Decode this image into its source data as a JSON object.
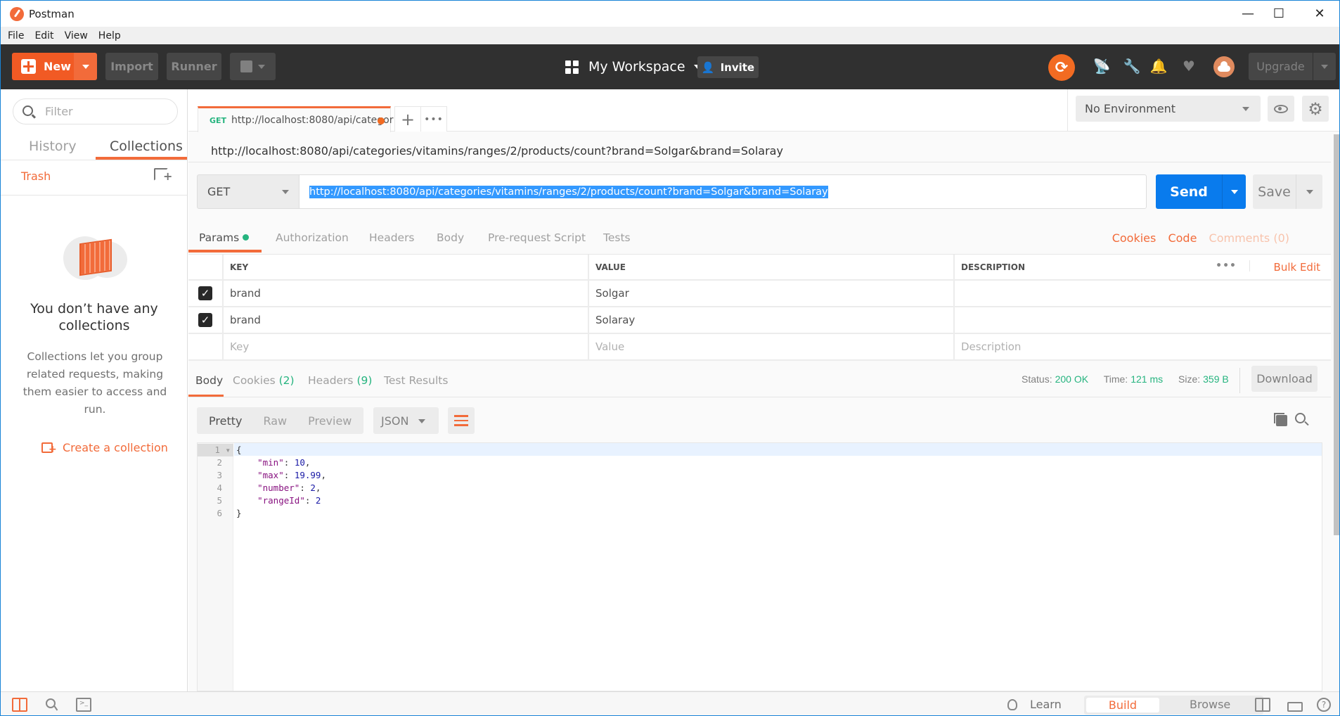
{
  "window": {
    "title": "Postman",
    "controls": {
      "minimize": "—",
      "maximize": "☐",
      "close": "✕"
    }
  },
  "menu": [
    "File",
    "Edit",
    "View",
    "Help"
  ],
  "toolbar": {
    "new_label": "New",
    "import_label": "Import",
    "runner_label": "Runner",
    "workspace_label": "My Workspace",
    "invite_label": "Invite",
    "upgrade_label": "Upgrade",
    "icons": [
      "sync-icon",
      "satellite-icon",
      "wrench-icon",
      "bell-icon",
      "heart-icon",
      "cloud-avatar-icon"
    ]
  },
  "sidebar": {
    "filter_placeholder": "Filter",
    "tabs": [
      {
        "label": "History",
        "active": false
      },
      {
        "label": "Collections",
        "active": true
      }
    ],
    "trash_label": "Trash",
    "empty_title": "You don’t have any collections",
    "empty_desc": "Collections let you group related requests, making them easier to access and run.",
    "create_label": "Create a collection"
  },
  "request_tab": {
    "method": "GET",
    "label": "http://localhost:8080/api/categor",
    "unsaved": true
  },
  "environment": {
    "selected": "No Environment"
  },
  "request": {
    "title": "http://localhost:8080/api/categories/vitamins/ranges/2/products/count?brand=Solgar&brand=Solaray",
    "method": "GET",
    "url": "http://localhost:8080/api/categories/vitamins/ranges/2/products/count?brand=Solgar&brand=Solaray",
    "send_label": "Send",
    "save_label": "Save",
    "tabs": [
      "Params",
      "Authorization",
      "Headers",
      "Body",
      "Pre-request Script",
      "Tests"
    ],
    "active_tab": "Params",
    "links": {
      "cookies": "Cookies",
      "code": "Code",
      "comments": "Comments (0)"
    }
  },
  "params": {
    "headers": {
      "key": "KEY",
      "value": "VALUE",
      "description": "DESCRIPTION"
    },
    "bulk_edit": "Bulk Edit",
    "rows": [
      {
        "checked": true,
        "key": "brand",
        "value": "Solgar",
        "description": ""
      },
      {
        "checked": true,
        "key": "brand",
        "value": "Solaray",
        "description": ""
      }
    ],
    "placeholders": {
      "key": "Key",
      "value": "Value",
      "description": "Description"
    }
  },
  "response": {
    "tabs": {
      "body": "Body",
      "cookies": "Cookies",
      "cookies_count": "(2)",
      "headers": "Headers",
      "headers_count": "(9)",
      "tests": "Test Results"
    },
    "status_label": "Status:",
    "status": "200 OK",
    "time_label": "Time:",
    "time": "121 ms",
    "size_label": "Size:",
    "size": "359 B",
    "download_label": "Download",
    "view_modes": [
      "Pretty",
      "Raw",
      "Preview"
    ],
    "format": "JSON",
    "lines": [
      {
        "n": "1",
        "text": "{"
      },
      {
        "n": "2",
        "key": "\"min\"",
        "val": "10",
        "trail": ","
      },
      {
        "n": "3",
        "key": "\"max\"",
        "val": "19.99",
        "trail": ","
      },
      {
        "n": "4",
        "key": "\"number\"",
        "val": "2",
        "trail": ","
      },
      {
        "n": "5",
        "key": "\"rangeId\"",
        "val": "2",
        "trail": ""
      },
      {
        "n": "6",
        "text": "}"
      }
    ]
  },
  "footer": {
    "learn_label": "Learn",
    "build_label": "Build",
    "browse_label": "Browse"
  },
  "colors": {
    "accent": "#f26b3a",
    "send_blue": "#097bed",
    "success_green": "#26b47f",
    "toolbar_bg": "#303030"
  }
}
